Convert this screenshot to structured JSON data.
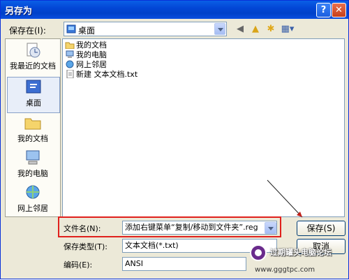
{
  "window": {
    "title": "另存为",
    "help": "?",
    "close": "✕"
  },
  "top": {
    "save_in_label": "保存在(I):",
    "location": "桌面"
  },
  "places": [
    {
      "label": "我最近的文档",
      "icon": "recent-docs-icon"
    },
    {
      "label": "桌面",
      "icon": "desktop-icon"
    },
    {
      "label": "我的文档",
      "icon": "my-documents-icon"
    },
    {
      "label": "我的电脑",
      "icon": "my-computer-icon"
    },
    {
      "label": "网上邻居",
      "icon": "network-places-icon"
    }
  ],
  "files": [
    {
      "name": "我的文档",
      "icon": "folder-icon"
    },
    {
      "name": "我的电脑",
      "icon": "computer-icon"
    },
    {
      "name": "网上邻居",
      "icon": "network-icon"
    },
    {
      "name": "新建 文本文档.txt",
      "icon": "text-file-icon"
    }
  ],
  "bottom": {
    "filename_label": "文件名(N):",
    "filename_value": "添加右键菜单“复制/移动到文件夹”.reg",
    "filetype_label": "保存类型(T):",
    "filetype_value": "文本文档(*.txt)",
    "encoding_label": "编码(E):",
    "encoding_value": "ANSI",
    "save_button": "保存(S)",
    "cancel_button": "取消"
  },
  "watermark": {
    "text": "过期罐头电脑论坛",
    "url": "www.gggtpc.com"
  },
  "colors": {
    "titlebar": "#0347d6",
    "dialog_bg": "#ece9d8",
    "highlight_box": "#e0201c"
  }
}
